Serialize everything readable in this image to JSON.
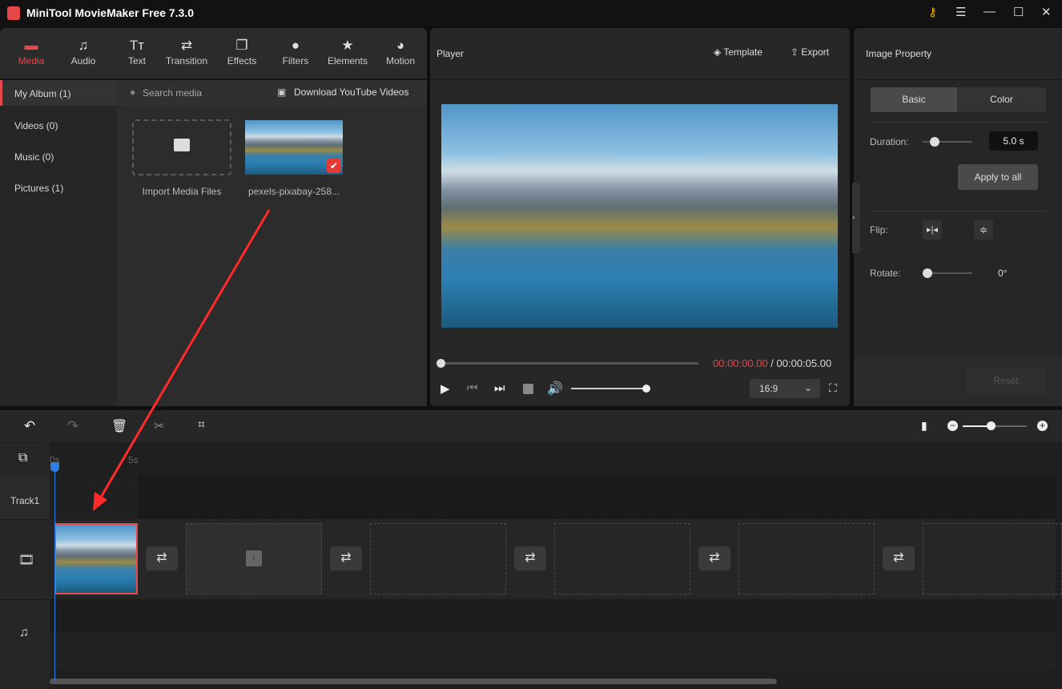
{
  "app": {
    "title": "MiniTool MovieMaker Free 7.3.0"
  },
  "tabs": [
    {
      "label": "Media",
      "icon": "folder-icon"
    },
    {
      "label": "Audio",
      "icon": "music-icon"
    },
    {
      "label": "Text",
      "icon": "text-icon"
    },
    {
      "label": "Transition",
      "icon": "transition-icon"
    },
    {
      "label": "Effects",
      "icon": "effects-icon"
    },
    {
      "label": "Filters",
      "icon": "filters-icon"
    },
    {
      "label": "Elements",
      "icon": "elements-icon"
    },
    {
      "label": "Motion",
      "icon": "motion-icon"
    }
  ],
  "sidebar": [
    {
      "label": "My Album (1)"
    },
    {
      "label": "Videos (0)"
    },
    {
      "label": "Music (0)"
    },
    {
      "label": "Pictures (1)"
    }
  ],
  "media": {
    "search_placeholder": "Search media",
    "download": "Download YouTube Videos",
    "import_label": "Import Media Files",
    "file_label": "pexels-pixabay-258..."
  },
  "player": {
    "title": "Player",
    "template": "Template",
    "export": "Export",
    "current_time": "00:00:00.00",
    "total_time": " / 00:00:05.00",
    "aspect": "16:9",
    "progress": 0,
    "volume": 0.9
  },
  "property": {
    "title": "Image Property",
    "tab_basic": "Basic",
    "tab_color": "Color",
    "duration_label": "Duration:",
    "duration_value": "5.0 s",
    "apply_all": "Apply to all",
    "flip_label": "Flip:",
    "rotate_label": "Rotate:",
    "rotate_value": "0°",
    "reset": "Reset"
  },
  "timeline": {
    "ruler": [
      "0s",
      "5s"
    ],
    "track1": "Track1"
  },
  "colors": {
    "accent": "#e5484d",
    "playhead": "#2f7ee6",
    "time": "#e5484d"
  }
}
